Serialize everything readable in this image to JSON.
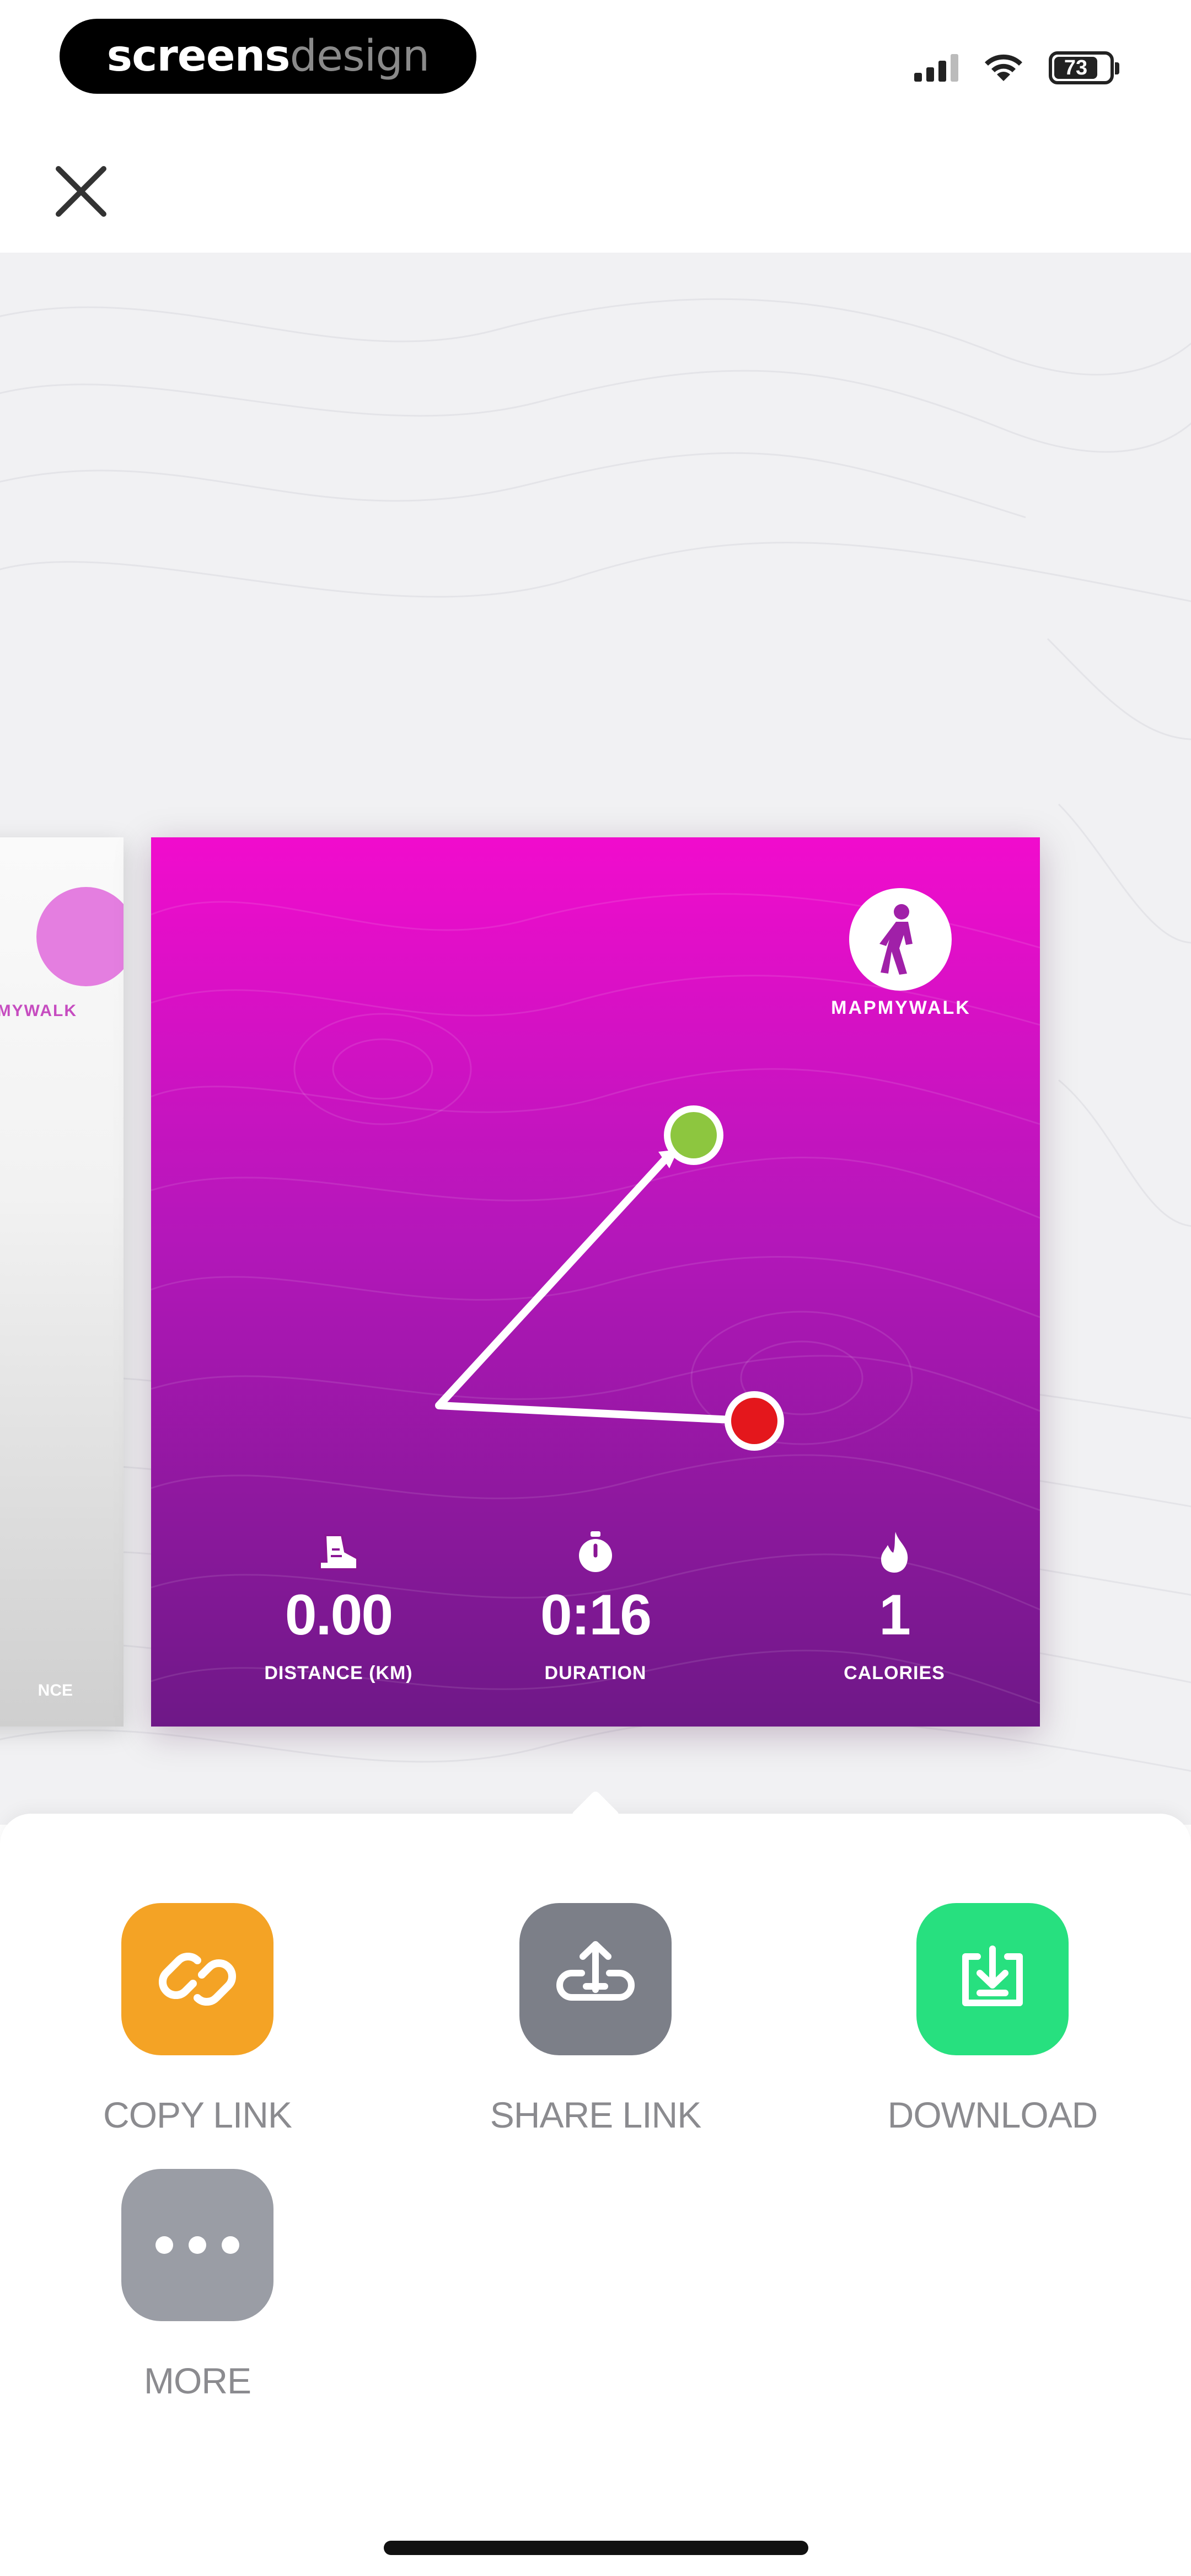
{
  "status_bar": {
    "brand_left": "screens",
    "brand_right": "design",
    "battery": "73"
  },
  "card": {
    "brand": "MAPMYWALK",
    "stats": [
      {
        "icon": "shoe-icon",
        "value": "0.00",
        "label": "DISTANCE (KM)"
      },
      {
        "icon": "stopwatch-icon",
        "value": "0:16",
        "label": "DURATION"
      },
      {
        "icon": "flame-icon",
        "value": "1",
        "label": "CALORIES"
      }
    ],
    "route": {
      "start_color": "#8dc63f",
      "end_color": "#e4171c"
    }
  },
  "prev_card": {
    "brand": "MAPMYWALK",
    "label": "NCE"
  },
  "actions": [
    {
      "label": "COPY LINK",
      "icon": "link-icon",
      "color": "#f4a325"
    },
    {
      "label": "SHARE LINK",
      "icon": "share-icon",
      "color": "#7c7f88"
    },
    {
      "label": "DOWNLOAD",
      "icon": "download-icon",
      "color": "#27e07f"
    },
    {
      "label": "MORE",
      "icon": "more-icon",
      "color": "#9a9da5"
    }
  ]
}
